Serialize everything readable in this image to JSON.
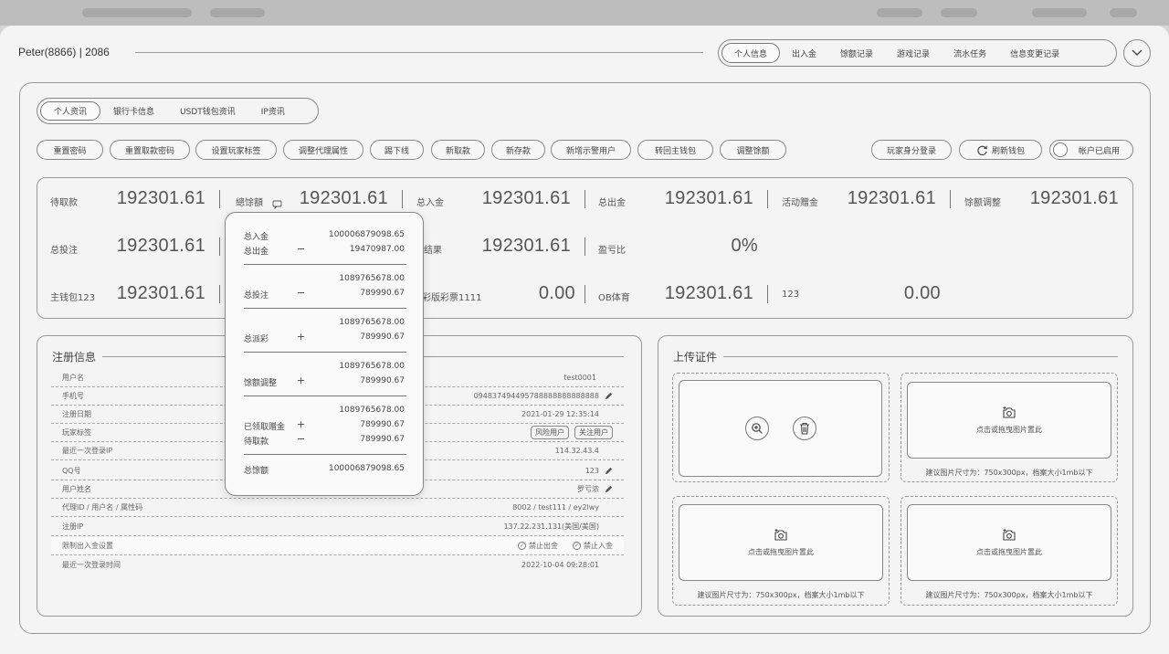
{
  "header": {
    "title": "Peter(8866) | 2086"
  },
  "topnav": {
    "items": [
      "个人信息",
      "出入金",
      "馀额记录",
      "游戏记录",
      "流水任务",
      "信息变更记录"
    ],
    "active": 0
  },
  "subtabs": {
    "items": [
      "个人资讯",
      "银行卡信息",
      "USDT钱包资讯",
      "IP资讯"
    ],
    "active": 0
  },
  "actions": {
    "left": [
      "重置密码",
      "重置取款密码",
      "设置玩家标签",
      "调整代理属性",
      "踢下线",
      "新取款",
      "新存款",
      "新增示警用户",
      "转回主钱包",
      "调整馀额"
    ],
    "impersonate": "玩家身分登录",
    "refresh": "刷新钱包",
    "account_status": "帐户已启用"
  },
  "stats": {
    "row1": [
      {
        "label": "待取款",
        "value": "192301.61"
      },
      {
        "label": "總馀額",
        "value": "192301.61"
      },
      {
        "label": "总入金",
        "value": "192301.61"
      },
      {
        "label": "总出金",
        "value": "192301.61"
      },
      {
        "label": "活动赠金",
        "value": "192301.61"
      },
      {
        "label": "馀额调整",
        "value": "192301.61"
      }
    ],
    "row2": [
      {
        "label": "总投注",
        "value": "192301.61"
      },
      {
        "label": "结果",
        "value": "192301.61"
      },
      {
        "label": "盈亏比",
        "value": "0%"
      }
    ],
    "row3": [
      {
        "label": "主钱包123",
        "value": "192301.61"
      },
      {
        "label": "彩版彩票1111",
        "value": "0.00"
      },
      {
        "label": "OB体育",
        "value": "192301.61"
      },
      {
        "label": "123",
        "value": "0.00"
      }
    ]
  },
  "popup": {
    "total_in_label": "总入金",
    "total_in": "100006879098.65",
    "total_out_label": "总出金",
    "total_out": "19470987.00",
    "sum1": "1089765678.00",
    "bet_label": "总投注",
    "bet": "789990.67",
    "sum2": "1089765678.00",
    "payout_label": "总派彩",
    "payout": "789990.67",
    "sum3": "1089765678.00",
    "adjust_label": "馀额调整",
    "adjust": "789990.67",
    "sum4": "1089765678.00",
    "bonus_label": "已领取赠金",
    "bonus": "789990.67",
    "pending_label": "待取款",
    "pending": "789990.67",
    "total_balance_label": "总馀额",
    "total_balance": "100006879098.65",
    "minus": "−",
    "plus": "+"
  },
  "register": {
    "title": "注册信息",
    "rows": [
      {
        "k": "用户名",
        "v": "test0001"
      },
      {
        "k": "手机号",
        "v": "094837494495788888888888888"
      },
      {
        "k": "注册日期",
        "v": "2021-01-29  12:35:14"
      },
      {
        "k": "玩家标签",
        "tags": [
          "风险用户",
          "关注用户"
        ]
      },
      {
        "k": "最近一次登录IP",
        "v": "114.32.43.4"
      },
      {
        "k": "QQ号",
        "v": "123"
      },
      {
        "k": "用户姓名",
        "v": "罗亏浓"
      },
      {
        "k": "代理ID / 用户名 / 属性码",
        "v": "8002 / test111 / ey2lwy"
      },
      {
        "k": "注册IP",
        "v": "137.22.231.131(美国/美国)"
      },
      {
        "k": "限制出入金设置",
        "checks": [
          "禁止出金",
          "禁止入金"
        ]
      },
      {
        "k": "最近一次登录时间",
        "v": "2022-10-04 09:28:01"
      }
    ]
  },
  "upload": {
    "title": "上传证件",
    "hint": "点击或拖曳图片置此",
    "size": "建议图片尺寸为：750x300px，档案大小1mb以下"
  }
}
